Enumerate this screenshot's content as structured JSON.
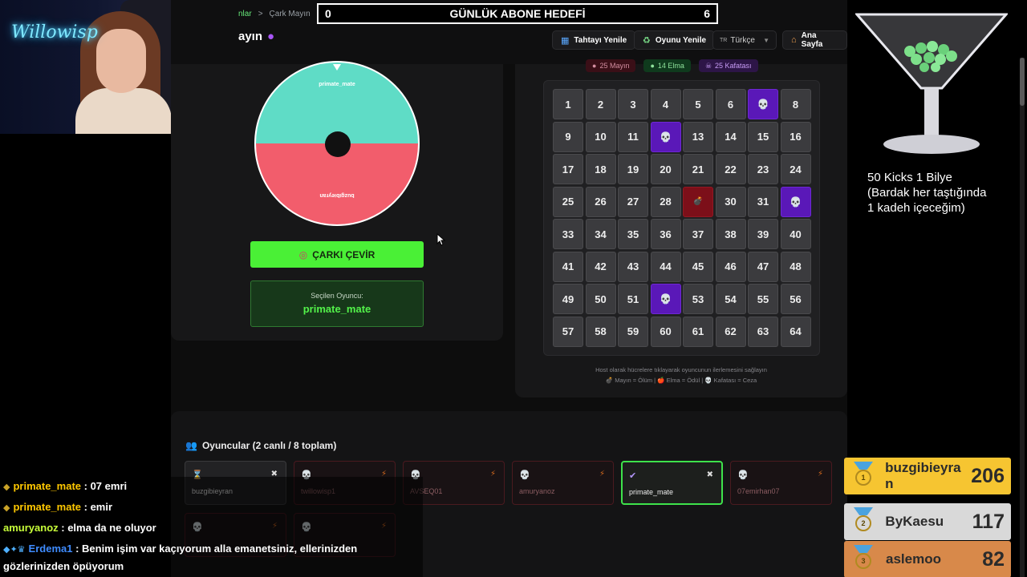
{
  "breadcrumb": {
    "parent": "nlar",
    "separator": ">",
    "current": "Çark Mayın"
  },
  "page_title": "ayın",
  "goal": {
    "left_value": "0",
    "title": "GÜNLÜK ABONE HEDEFİ",
    "right_value": "6"
  },
  "toolbar": {
    "refresh_board": "Tahtayı Yenile",
    "refresh_game": "Oyunu Yenile",
    "language": "Türkçe",
    "language_code": "TR",
    "home": "Ana Sayfa"
  },
  "wheel": {
    "top_segment": "primate_mate",
    "bottom_segment": "buzgibieyran",
    "colors": {
      "top": "#5fdcc6",
      "bottom": "#f25d6c"
    },
    "spin_button": "ÇARKI ÇEVİR",
    "selected_label": "Seçilen Oyuncu:",
    "selected_value": "primate_mate"
  },
  "board": {
    "chips": {
      "mines": "25 Mayın",
      "apples": "14 Elma",
      "skulls": "25 Kafatası"
    },
    "cells": [
      {
        "n": "1"
      },
      {
        "n": "2"
      },
      {
        "n": "3"
      },
      {
        "n": "4"
      },
      {
        "n": "5"
      },
      {
        "n": "6"
      },
      {
        "n": "💀",
        "kind": "skull"
      },
      {
        "n": "8"
      },
      {
        "n": "9"
      },
      {
        "n": "10"
      },
      {
        "n": "11"
      },
      {
        "n": "💀",
        "kind": "skull"
      },
      {
        "n": "13"
      },
      {
        "n": "14"
      },
      {
        "n": "15"
      },
      {
        "n": "16"
      },
      {
        "n": "17"
      },
      {
        "n": "18"
      },
      {
        "n": "19"
      },
      {
        "n": "20"
      },
      {
        "n": "21"
      },
      {
        "n": "22"
      },
      {
        "n": "23"
      },
      {
        "n": "24"
      },
      {
        "n": "25"
      },
      {
        "n": "26"
      },
      {
        "n": "27"
      },
      {
        "n": "28"
      },
      {
        "n": "💣",
        "kind": "mine"
      },
      {
        "n": "30"
      },
      {
        "n": "31"
      },
      {
        "n": "💀",
        "kind": "skull"
      },
      {
        "n": "33"
      },
      {
        "n": "34"
      },
      {
        "n": "35"
      },
      {
        "n": "36"
      },
      {
        "n": "37"
      },
      {
        "n": "38"
      },
      {
        "n": "39"
      },
      {
        "n": "40"
      },
      {
        "n": "41"
      },
      {
        "n": "42"
      },
      {
        "n": "43"
      },
      {
        "n": "44"
      },
      {
        "n": "45"
      },
      {
        "n": "46"
      },
      {
        "n": "47"
      },
      {
        "n": "48"
      },
      {
        "n": "49"
      },
      {
        "n": "50"
      },
      {
        "n": "51"
      },
      {
        "n": "💀",
        "kind": "skull"
      },
      {
        "n": "53"
      },
      {
        "n": "54"
      },
      {
        "n": "55"
      },
      {
        "n": "56"
      },
      {
        "n": "57"
      },
      {
        "n": "58"
      },
      {
        "n": "59"
      },
      {
        "n": "60"
      },
      {
        "n": "61"
      },
      {
        "n": "62"
      },
      {
        "n": "63"
      },
      {
        "n": "64"
      }
    ],
    "hint_line1": "Host olarak hücrelere tıklayarak oyuncunun ilerlemesini sağlayın",
    "hint_line2": "💣 Mayın = Ölüm | 🍎 Elma = Ödül | 💀 Kafatası = Ceza"
  },
  "players": {
    "title": "Oyuncular (2 canlı / 8 toplam)",
    "list": [
      {
        "name": "buzgibieyran",
        "state_icon": "⌛",
        "action_icon": "✖",
        "status": "alive"
      },
      {
        "name": "twillowisp1",
        "state_icon": "💀",
        "action_icon": "⚡",
        "status": "dead"
      },
      {
        "name": "AVSEQ01",
        "state_icon": "💀",
        "action_icon": "⚡",
        "status": "dead"
      },
      {
        "name": "amuryanoz",
        "state_icon": "💀",
        "action_icon": "⚡",
        "status": "dead"
      },
      {
        "name": "primate_mate",
        "state_icon": "✔",
        "action_icon": "✖",
        "status": "selected"
      },
      {
        "name": "07emirhan07",
        "state_icon": "💀",
        "action_icon": "⚡",
        "status": "dead"
      },
      {
        "name": "",
        "state_icon": "💀",
        "action_icon": "⚡",
        "status": "dead"
      },
      {
        "name": "",
        "state_icon": "💀",
        "action_icon": "⚡",
        "status": "dead"
      }
    ]
  },
  "chat": [
    {
      "user": "primate_mate",
      "text": ": 07 emri"
    },
    {
      "user": "primate_mate",
      "text": ": emir"
    },
    {
      "user": "amuryanoz",
      "text": ": elma da ne oluyor"
    },
    {
      "user": "Erdema1",
      "text": ": Benim işim var kaçıyorum alla emanetsiniz, ellerinizden"
    },
    {
      "user": "",
      "text": "gözlerinizden öpüyorum"
    }
  ],
  "overlay": {
    "webcam_text": "Willowisp",
    "kicks_text_1": "50 Kicks 1 Bilye",
    "kicks_text_2": "(Bardak her taştığında",
    "kicks_text_3": "1 kadeh içeceğim)"
  },
  "leaderboard": [
    {
      "rank": "1",
      "name": "buzgibieyra n",
      "score": "206",
      "color": "#f6c531"
    },
    {
      "rank": "2",
      "name": "ByKaesu",
      "score": "117",
      "color": "#d9d9d9"
    },
    {
      "rank": "3",
      "name": "aslemoo",
      "score": "82",
      "color": "#d8894a"
    }
  ]
}
